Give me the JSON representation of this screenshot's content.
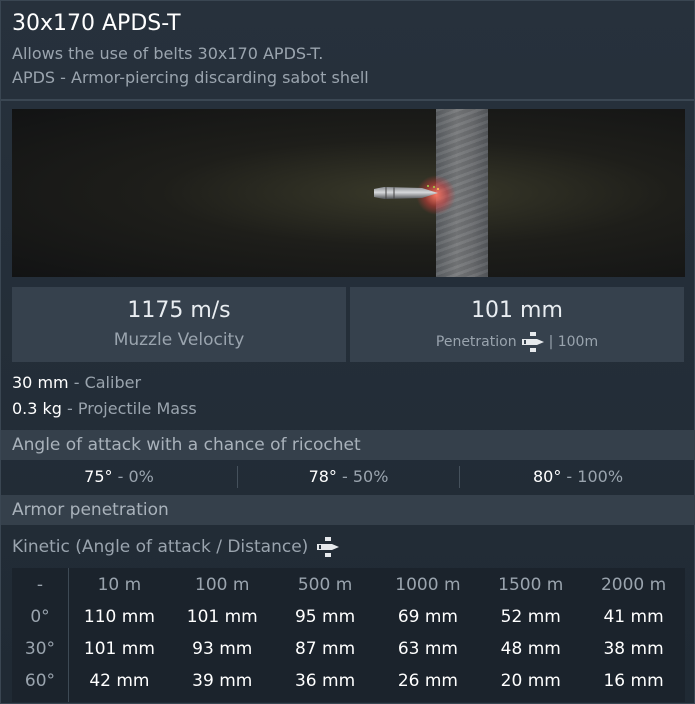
{
  "header": {
    "title": "30x170 APDS-T",
    "description_line1": "Allows the use of belts 30x170 APDS-T.",
    "description_line2": "APDS - Armor-piercing discarding sabot shell"
  },
  "stats": {
    "velocity_value": "1175 m/s",
    "velocity_label": "Muzzle Velocity",
    "penetration_value": "101 mm",
    "penetration_label": "Penetration",
    "penetration_distance": "| 100m"
  },
  "properties": {
    "caliber_value": "30 mm",
    "caliber_label": " - Caliber",
    "mass_value": "0.3 kg",
    "mass_label": " - Projectile Mass"
  },
  "ricochet": {
    "title": "Angle of attack with a chance of ricochet",
    "items": [
      {
        "angle": "75°",
        "chance": " - 0%"
      },
      {
        "angle": "78°",
        "chance": " - 50%"
      },
      {
        "angle": "80°",
        "chance": " - 100%"
      }
    ]
  },
  "armor": {
    "title": "Armor penetration",
    "kinetic_label": "Kinetic (Angle of attack / Distance)",
    "table": {
      "corner": "-",
      "columns": [
        "10 m",
        "100 m",
        "500 m",
        "1000 m",
        "1500 m",
        "2000 m"
      ],
      "rows": [
        {
          "angle": "0°",
          "values": [
            "110 mm",
            "101 mm",
            "95 mm",
            "69 mm",
            "52 mm",
            "41 mm"
          ]
        },
        {
          "angle": "30°",
          "values": [
            "101 mm",
            "93 mm",
            "87 mm",
            "63 mm",
            "48 mm",
            "38 mm"
          ]
        },
        {
          "angle": "60°",
          "values": [
            "42 mm",
            "39 mm",
            "36 mm",
            "26 mm",
            "20 mm",
            "16 mm"
          ]
        }
      ]
    }
  },
  "icons": {
    "shell": "shell-icon",
    "shell_color": "#ffffff"
  },
  "colors": {
    "background": "#27313c",
    "panel": "#36414d",
    "section_header": "#35404b",
    "table_bg": "#1b232c",
    "muted_text": "#9aa4ae"
  }
}
